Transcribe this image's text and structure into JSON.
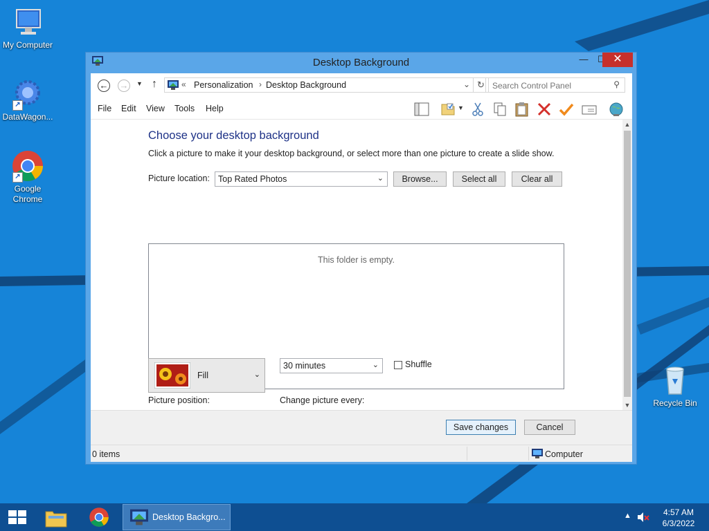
{
  "desktop": {
    "icons": [
      {
        "label": "My Computer"
      },
      {
        "label": "DataWagon..."
      },
      {
        "label": "Google Chrome"
      },
      {
        "label": "Recycle Bin"
      }
    ]
  },
  "window": {
    "title": "Desktop Background",
    "controls": {
      "minimize": "—",
      "maximize": "☐",
      "close": "✕"
    },
    "address": {
      "prefix": "«",
      "breadcrumbs": [
        "Personalization",
        "Desktop Background"
      ],
      "separator": "›"
    },
    "search": {
      "placeholder": "Search Control Panel"
    },
    "menu": [
      "File",
      "Edit",
      "View",
      "Tools",
      "Help"
    ],
    "toolbar_icons": [
      "layout-icon",
      "folder-icon",
      "cut-icon",
      "copy-icon",
      "paste-icon",
      "delete-icon",
      "check-icon",
      "properties-icon",
      "globe-icon"
    ],
    "content": {
      "heading": "Choose your desktop background",
      "subtext": "Click a picture to make it your desktop background, or select more than one picture to create a slide show.",
      "picture_location_label": "Picture location:",
      "picture_location_value": "Top Rated Photos",
      "browse_label": "Browse...",
      "select_all_label": "Select all",
      "clear_all_label": "Clear all",
      "empty_text": "This folder is empty.",
      "picture_position_label": "Picture position:",
      "picture_position_value": "Fill",
      "change_every_label": "Change picture every:",
      "change_every_value": "30 minutes",
      "shuffle_label": "Shuffle",
      "shuffle_checked": false
    },
    "footer": {
      "save_label": "Save changes",
      "cancel_label": "Cancel"
    },
    "status": {
      "items": "0 items",
      "location": "Computer"
    }
  },
  "taskbar": {
    "active_item": "Desktop Backgro...",
    "time": "4:57 AM",
    "date": "6/3/2022"
  },
  "colors": {
    "accent": "#1684d8",
    "heading": "#1e3287",
    "close": "#c7302b",
    "taskbar": "#0e4f92"
  }
}
